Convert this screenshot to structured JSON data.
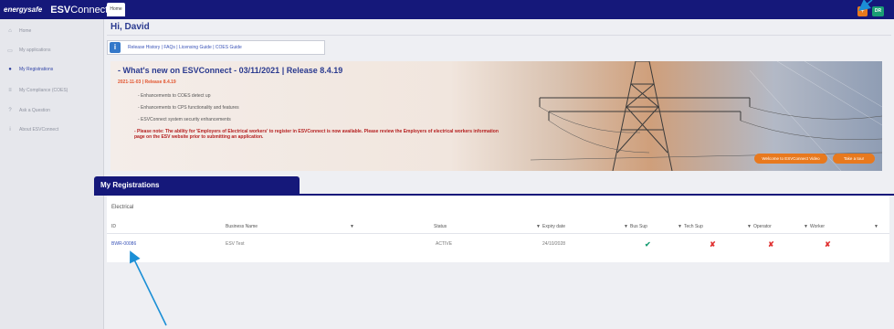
{
  "topbar": {
    "brand_energy": "energysafe",
    "brand_esv": "ESV",
    "brand_connect": "Connect",
    "tab_home": "Home",
    "user_initials": "DR",
    "orange_button_label": "+"
  },
  "sidebar": {
    "items": [
      {
        "label": "Home",
        "icon": "home-icon"
      },
      {
        "label": "My applications",
        "icon": "folder-icon"
      },
      {
        "label": "My Registrations",
        "icon": "pin-icon",
        "active": true
      },
      {
        "label": "My Compliance (COES)",
        "icon": "document-icon"
      },
      {
        "label": "Ask a Question",
        "icon": "question-icon"
      },
      {
        "label": "About ESVConnect",
        "icon": "info-icon"
      }
    ]
  },
  "greeting": "Hi, David",
  "info_links": "Release History | FAQs | Licensing Guide | COES Guide",
  "banner": {
    "title": "- What's new on ESVConnect - 03/11/2021 | Release 8.4.19",
    "subtitle": "2021-11-03 | Release 8.4.19",
    "items": [
      "- Enhancements to COES detect up",
      "- Enhancements to CPS functionality and features",
      "- ESVConnect system security enhancements"
    ],
    "note": "- Please note: The ability for 'Employers of Electrical workers' to register in ESVConnect is now available. Please review the Employers of electrical workers information page on the ESV website prior to submitting an application.",
    "button_video": "Welcome to ESVConnect Video",
    "button_tour": "Take a tour"
  },
  "registrations": {
    "tab_label": "My Registrations",
    "category": "Electrical",
    "columns": [
      "ID",
      "Business Name",
      "Status",
      "Expiry date",
      "Bus Sup",
      "Tech Sup",
      "Operator",
      "Worker"
    ],
    "rows": [
      {
        "id": "BWR-00086",
        "business_name": "ESV Test",
        "status": "ACTIVE",
        "expiry": "24/10/2028",
        "bus_sup": "✔",
        "tech_sup": "✘",
        "operator": "✘",
        "worker": "✘"
      }
    ]
  },
  "colors": {
    "navy": "#15187a",
    "accent_orange": "#e8791e",
    "accent_green": "#1a9e74",
    "annotation_arrow": "#1b8fd6"
  }
}
